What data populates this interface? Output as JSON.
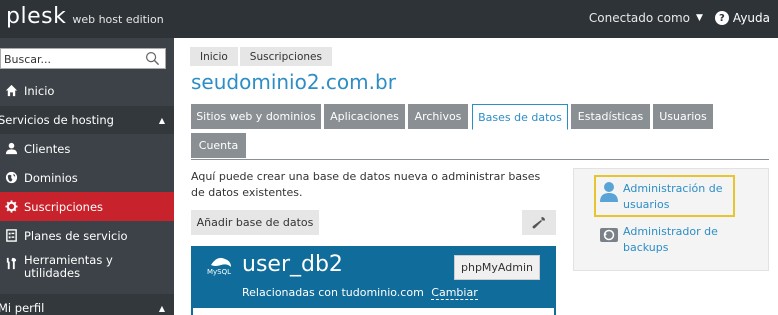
{
  "header": {
    "logo_main": "plesk",
    "logo_sub": "web host edition",
    "connected_label": "Conectado como",
    "help_label": "Ayuda"
  },
  "sidebar": {
    "search_placeholder": "Buscar...",
    "items": [
      {
        "label": "Inicio",
        "icon": "home-icon"
      },
      {
        "section": "Servicios de hosting"
      },
      {
        "label": "Clientes",
        "icon": "user-icon"
      },
      {
        "label": "Dominios",
        "icon": "globe-icon"
      },
      {
        "label": "Suscripciones",
        "icon": "gear-icon",
        "active": true
      },
      {
        "label": "Planes de servicio",
        "icon": "plan-icon"
      },
      {
        "label": "Herramientas y utilidades",
        "icon": "tools-icon"
      },
      {
        "section": "Mi perfil"
      }
    ],
    "section_hosting": "Servicios de hosting",
    "section_profile": "Mi perfil"
  },
  "breadcrumb": [
    "Inicio",
    "Suscripciones"
  ],
  "page_title": "seudominio2.com.br",
  "tabs": [
    {
      "label": "Sitios web y dominios"
    },
    {
      "label": "Aplicaciones"
    },
    {
      "label": "Archivos"
    },
    {
      "label": "Bases de datos",
      "active": true
    },
    {
      "label": "Estadísticas"
    },
    {
      "label": "Usuarios"
    },
    {
      "label": "Cuenta"
    }
  ],
  "intro_text": "Aquí puede crear una base de datos nueva o administrar bases de datos existentes.",
  "add_db_label": "Añadir base de datos",
  "database": {
    "type_label": "MySQL",
    "name": "user_db2",
    "related_prefix": "Relacionadas con tudominio.com",
    "change_label": "Cambiar",
    "phpmyadmin_label": "phpMyAdmin"
  },
  "side_panel": {
    "user_admin_line1": "Administración de",
    "user_admin_line2": "usuarios",
    "backup_admin_line1": "Administrador de",
    "backup_admin_line2": "backups"
  },
  "colors": {
    "topbar": "#2e3338",
    "sidebar": "#3c4247",
    "active_red": "#c8232c",
    "accent_blue": "#2d8ec6",
    "card_blue": "#0f6c9b",
    "highlight": "#e6c531"
  }
}
